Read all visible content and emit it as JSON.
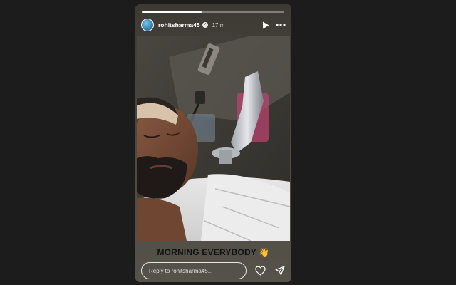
{
  "story": {
    "progress_fraction": 0.42,
    "progress_color": "#ffffff"
  },
  "header": {
    "username": "rohitsharma45",
    "verified_icon": "verified-badge-icon",
    "time": "17 m",
    "play_icon": "play-icon",
    "more_icon": "more-options-icon"
  },
  "caption": {
    "text": "MORNING EVERYBODY",
    "emoji": "👋"
  },
  "footer": {
    "reply_placeholder": "Reply to rohitsharma45...",
    "like_icon": "heart-icon",
    "share_icon": "send-icon"
  }
}
